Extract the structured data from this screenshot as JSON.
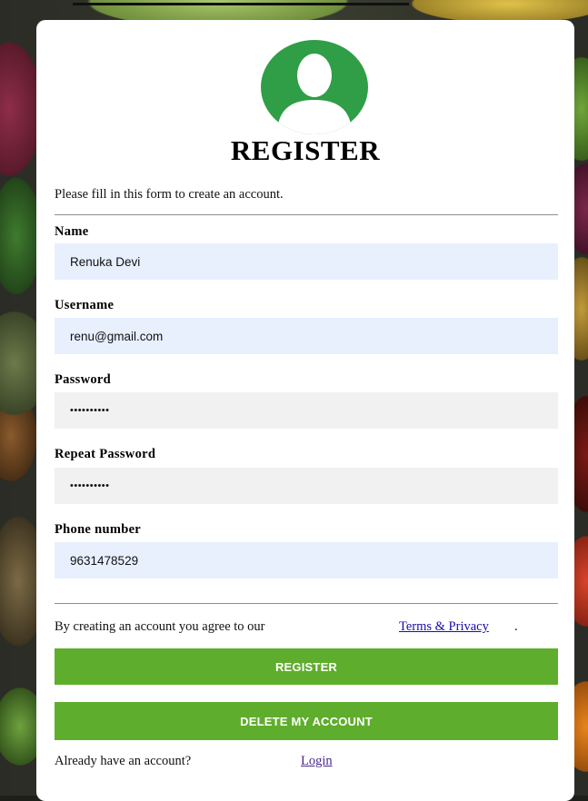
{
  "form": {
    "title": "REGISTER",
    "intro": "Please fill in this form to create an account.",
    "fields": {
      "name": {
        "label": "Name",
        "value": "Renuka Devi"
      },
      "username": {
        "label": "Username",
        "value": "renu@gmail.com"
      },
      "password": {
        "label": "Password",
        "value": "••••••••••"
      },
      "repeat_password": {
        "label": "Repeat Password",
        "value": "••••••••••"
      },
      "phone": {
        "label": "Phone number",
        "value": "9631478529"
      }
    },
    "agree_text": "By creating an account you agree to our",
    "terms_link": "Terms & Privacy",
    "terms_suffix": ".",
    "register_button": "REGISTER",
    "delete_button": "DELETE MY ACCOUNT",
    "have_account_text": "Already have an account?",
    "login_link": "Login"
  },
  "icons": {
    "avatar": "user-silhouette-icon"
  },
  "colors": {
    "accent_green": "#5fad2c",
    "avatar_green": "#2f9e46",
    "autofill_blue": "#e8f0fe",
    "password_gray": "#f1f1f1"
  }
}
